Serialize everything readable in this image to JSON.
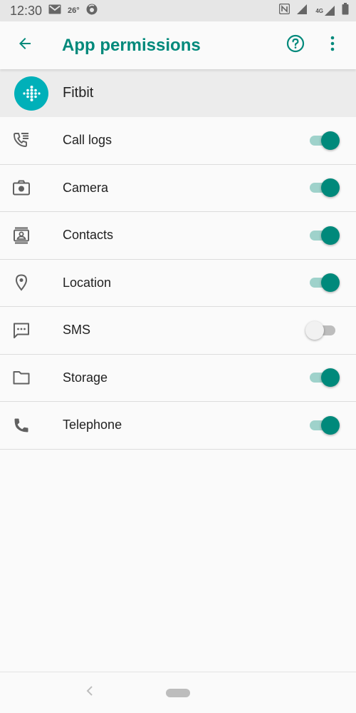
{
  "status_bar": {
    "time": "12:30",
    "temperature": "26°",
    "network": "4G"
  },
  "header": {
    "title": "App permissions",
    "back_icon": "arrow-left-icon",
    "help_icon": "help-circle-icon",
    "menu_icon": "more-vert-icon"
  },
  "app": {
    "name": "Fitbit",
    "logo_color": "#00b0b9"
  },
  "permissions": [
    {
      "label": "Call logs",
      "icon": "call-log-icon",
      "enabled": true
    },
    {
      "label": "Camera",
      "icon": "camera-icon",
      "enabled": true
    },
    {
      "label": "Contacts",
      "icon": "contacts-icon",
      "enabled": true
    },
    {
      "label": "Location",
      "icon": "location-pin-icon",
      "enabled": true
    },
    {
      "label": "SMS",
      "icon": "sms-icon",
      "enabled": false
    },
    {
      "label": "Storage",
      "icon": "folder-icon",
      "enabled": true
    },
    {
      "label": "Telephone",
      "icon": "phone-icon",
      "enabled": true
    }
  ],
  "colors": {
    "accent": "#00897b",
    "toggle_track_on": "#9fd2cb",
    "toggle_track_off": "#bdbdbd"
  }
}
